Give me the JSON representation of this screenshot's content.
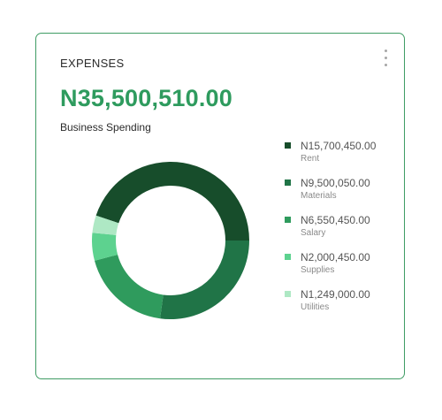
{
  "card": {
    "title": "EXPENSES",
    "total": "N35,500,510.00",
    "subtitle": "Business Spending",
    "menu_icon": "kebab-menu-icon"
  },
  "chart_data": {
    "type": "pie",
    "donut": true,
    "categories": [
      "Rent",
      "Materials",
      "Salary",
      "Supplies",
      "Utilities"
    ],
    "values": [
      15700450,
      9500050,
      6550450,
      2000450,
      1249000
    ],
    "colors": [
      "#174d2b",
      "#207447",
      "#2f9b5d",
      "#5dd28f",
      "#aee8c4"
    ],
    "title": "",
    "legend_position": "right"
  },
  "legend": [
    {
      "value": "N15,700,450.00",
      "label": "Rent",
      "color": "#174d2b"
    },
    {
      "value": "N9,500,050.00",
      "label": "Materials",
      "color": "#207447"
    },
    {
      "value": "N6,550,450.00",
      "label": "Salary",
      "color": "#2f9b5d"
    },
    {
      "value": "N2,000,450.00",
      "label": "Supplies",
      "color": "#5dd28f"
    },
    {
      "value": "N1,249,000.00",
      "label": "Utilities",
      "color": "#aee8c4"
    }
  ]
}
